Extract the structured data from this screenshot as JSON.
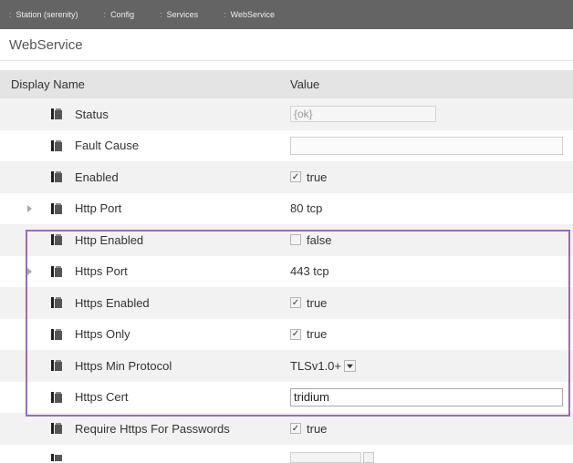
{
  "breadcrumb": [
    "Station (serenity)",
    "Config",
    "Services",
    "WebService"
  ],
  "page_title": "WebService",
  "table": {
    "columns": {
      "name": "Display Name",
      "value": "Value"
    },
    "rows": [
      {
        "label": "Status",
        "kind": "readonly",
        "value": "{ok}",
        "expandable": false
      },
      {
        "label": "Fault Cause",
        "kind": "readonly-wide",
        "value": "",
        "expandable": false
      },
      {
        "label": "Enabled",
        "kind": "checkbox",
        "checked": true,
        "value": "true",
        "expandable": false
      },
      {
        "label": "Http Port",
        "kind": "text",
        "value": "80 tcp",
        "expandable": true
      },
      {
        "label": "Http Enabled",
        "kind": "checkbox",
        "checked": false,
        "value": "false",
        "expandable": false
      },
      {
        "label": "Https Port",
        "kind": "text",
        "value": "443 tcp",
        "expandable": true
      },
      {
        "label": "Https Enabled",
        "kind": "checkbox",
        "checked": true,
        "value": "true",
        "expandable": false
      },
      {
        "label": "Https Only",
        "kind": "checkbox",
        "checked": true,
        "value": "true",
        "expandable": false
      },
      {
        "label": "Https Min Protocol",
        "kind": "dropdown",
        "value": "TLSv1.0+",
        "expandable": false
      },
      {
        "label": "Https Cert",
        "kind": "input",
        "value": "tridium",
        "expandable": false
      },
      {
        "label": "Require Https For Passwords",
        "kind": "checkbox",
        "checked": true,
        "value": "true",
        "expandable": false
      }
    ]
  },
  "icons": {
    "slot": "slot-icon",
    "expand": "expand-arrow-icon",
    "check": "checkmark-icon",
    "dropdown": "dropdown-arrow-icon"
  },
  "colors": {
    "breadcrumb_bg": "#646464",
    "header_bg": "#e4e4e4",
    "row_alt": "#f2f2f2",
    "highlight": "#9b6bb5"
  }
}
